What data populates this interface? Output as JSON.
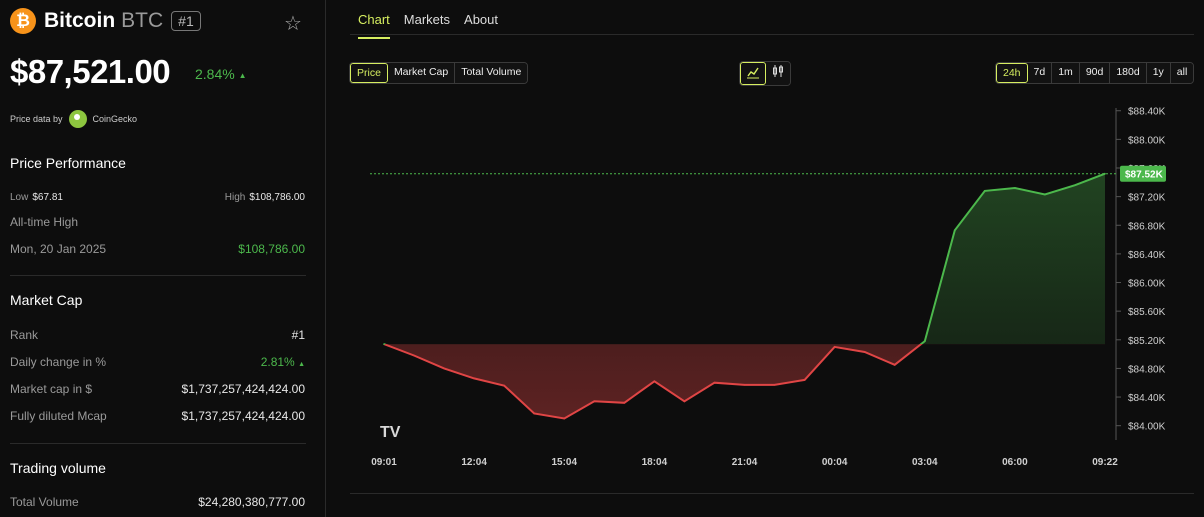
{
  "coin": {
    "logo_glyph": "₿",
    "name": "Bitcoin",
    "symbol": "BTC",
    "rank_badge": "#1",
    "star_icon": "star-icon",
    "price": "$87,521.00",
    "change": "2.84%",
    "change_arrow": "▲",
    "price_data_label": "Price data by",
    "price_data_source": "CoinGecko"
  },
  "performance": {
    "title": "Price Performance",
    "low_label": "Low",
    "low_value": "$67.81",
    "high_label": "High",
    "high_value": "$108,786.00",
    "ath_label": "All-time High",
    "ath_date": "Mon, 20 Jan 2025",
    "ath_value": "$108,786.00"
  },
  "market_cap": {
    "title": "Market Cap",
    "rank_label": "Rank",
    "rank_value": "#1",
    "daily_change_label": "Daily change in %",
    "daily_change_value": "2.81%",
    "daily_change_arrow": "▲",
    "mcap_label": "Market cap in $",
    "mcap_value": "$1,737,257,424,424.00",
    "fd_label": "Fully diluted Mcap",
    "fd_value": "$1,737,257,424,424.00"
  },
  "trading": {
    "title": "Trading volume",
    "total_label": "Total Volume",
    "total_value": "$24,280,380,777.00"
  },
  "tabs": [
    {
      "label": "Chart",
      "active": true
    },
    {
      "label": "Markets",
      "active": false
    },
    {
      "label": "About",
      "active": false
    }
  ],
  "metric_buttons": [
    {
      "label": "Price",
      "active": true
    },
    {
      "label": "Market Cap",
      "active": false
    },
    {
      "label": "Total Volume",
      "active": false
    }
  ],
  "view_buttons": [
    {
      "icon": "line-chart-icon",
      "active": true
    },
    {
      "icon": "candlestick-icon",
      "active": false
    }
  ],
  "range_buttons": [
    {
      "label": "24h",
      "active": true
    },
    {
      "label": "7d",
      "active": false
    },
    {
      "label": "1m",
      "active": false
    },
    {
      "label": "90d",
      "active": false
    },
    {
      "label": "180d",
      "active": false
    },
    {
      "label": "1y",
      "active": false
    },
    {
      "label": "all",
      "active": false
    }
  ],
  "colors": {
    "up": "#4cb84c",
    "down": "#e04545",
    "accent": "#d6ee60",
    "btc": "#f7931a"
  },
  "chart_data": {
    "type": "line",
    "x": [
      "09:01",
      "10:00",
      "11:00",
      "12:04",
      "13:00",
      "14:00",
      "15:04",
      "16:00",
      "17:00",
      "18:04",
      "19:00",
      "20:00",
      "21:04",
      "22:00",
      "23:00",
      "00:04",
      "01:00",
      "02:00",
      "03:04",
      "04:00",
      "05:00",
      "06:00",
      "07:00",
      "08:00",
      "09:22"
    ],
    "values": [
      85140,
      84980,
      84800,
      84660,
      84560,
      84170,
      84100,
      84340,
      84320,
      84620,
      84340,
      84600,
      84570,
      84570,
      84640,
      85100,
      85030,
      84850,
      85180,
      86730,
      87280,
      87320,
      87230,
      87360,
      87520
    ],
    "baseline": 85140,
    "current_label": "$87.52K",
    "current_value": 87520,
    "ylim": [
      83800,
      88550
    ],
    "y_ticks": [
      84000,
      84400,
      84800,
      85200,
      85600,
      86000,
      86400,
      86800,
      87200,
      87600,
      88000,
      88400
    ],
    "y_tick_labels": [
      "$84.00K",
      "$84.40K",
      "$84.80K",
      "$85.20K",
      "$85.60K",
      "$86.00K",
      "$86.40K",
      "$86.80K",
      "$87.20K",
      "$87.60K",
      "$88.00K",
      "$88.40K"
    ],
    "x_tick_labels": [
      "09:01",
      "12:04",
      "15:04",
      "18:04",
      "21:04",
      "00:04",
      "03:04",
      "06:00",
      "09:22"
    ],
    "x_tick_index": [
      0,
      3,
      6,
      9,
      12,
      15,
      18,
      21,
      24
    ],
    "watermark": "TV"
  }
}
